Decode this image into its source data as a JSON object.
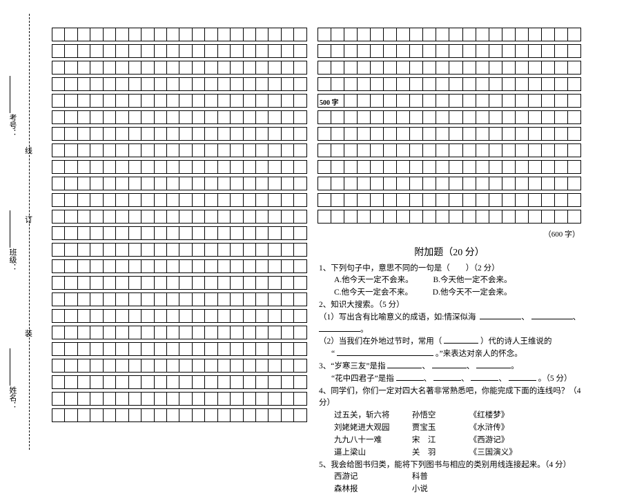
{
  "binding": {
    "name_label": "姓名：",
    "class_label": "班级：",
    "number_label": "考号：",
    "zhuang": "装",
    "ding": "订",
    "xian": "线"
  },
  "grid": {
    "marker500": "500 字",
    "marker600": "（600 字）"
  },
  "bonus": {
    "title": "附加题（20 分）",
    "q1_line1": "1、下列句子中，意思不同的一句是（　　）（2 分）",
    "q1_a": "A.他今天一定不会来。",
    "q1_b": "B.今天他一定不会来。",
    "q1_c": "C.他今天一定会不来。",
    "q1_d": "D.他今天不一定会来。",
    "q2_head": "2、知识大搜索。（5 分）",
    "q2_1": "（1）写出含有比喻意义的成语，如:情深似海",
    "q2_2a": "（2）当我们在外地过节时，常用（",
    "q2_2b": "）代的诗人王维说的",
    "q2_2c": "“",
    "q2_2d": "。”来表达对亲人的怀念。",
    "q3_a": "3、“岁寒三友”是指",
    "q3_b": "“花中四君子”是指",
    "q3_points": "。（5 分）",
    "q4_head": "4、同学们，你们一定对四大名著非常熟悉吧，你能完成下面的连线吗？（4 分）",
    "q4_r1a": "过五关，斩六将",
    "q4_r1b": "孙悟空",
    "q4_r1c": "《红楼梦》",
    "q4_r2a": "刘姥姥进大观园",
    "q4_r2b": "贾宝玉",
    "q4_r2c": "《水浒传》",
    "q4_r3a": "九九八十一难",
    "q4_r3b": "宋　江",
    "q4_r3c": "《西游记》",
    "q4_r4a": "逼上梁山",
    "q4_r4b": "关　羽",
    "q4_r4c": "《三国演义》",
    "q5_head": "5、我会给图书归类，能将下列图书与相应的类别用线连接起来。（4 分）",
    "q5_r1a": "西游记",
    "q5_r1b": "科普",
    "q5_r2a": "森林报",
    "q5_r2b": "小说"
  }
}
